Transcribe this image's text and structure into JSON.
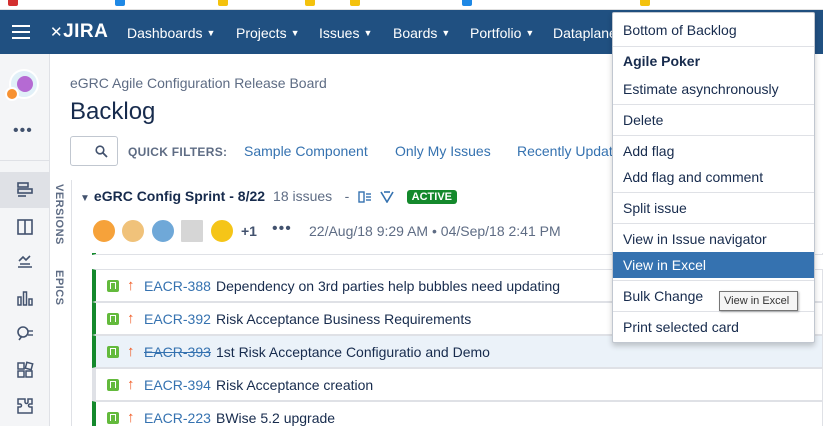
{
  "header": {
    "logo": "JIRA",
    "nav": [
      {
        "label": "Dashboards"
      },
      {
        "label": "Projects"
      },
      {
        "label": "Issues"
      },
      {
        "label": "Boards"
      },
      {
        "label": "Portfolio"
      },
      {
        "label": "Dataplane"
      }
    ]
  },
  "sidebar": {
    "more": "•••",
    "icons": [
      "backlog-icon",
      "board-icon",
      "releases-icon",
      "reports-icon",
      "issues-search-icon",
      "components-icon",
      "add-ons-icon"
    ]
  },
  "main": {
    "project_name": "eGRC Agile Configuration Release Board",
    "title": "Backlog",
    "quick_filters_label": "QUICK FILTERS:",
    "quick_filters": [
      "Sample Component",
      "Only My Issues",
      "Recently Updated"
    ],
    "side_tabs": [
      "VERSIONS",
      "EPICS"
    ]
  },
  "sprint": {
    "name": "eGRC Config Sprint - 8/22",
    "count": "18 issues",
    "status": "ACTIVE",
    "extra_assignees": "+1",
    "more": "•••",
    "start": "22/Aug/18 9:29 AM",
    "sep": "•",
    "end": "04/Sep/18 2:41 PM"
  },
  "issues": [
    {
      "key": "EACR-388",
      "summary": "Dependency on 3rd parties help bubbles need updating",
      "done": false,
      "selected": false
    },
    {
      "key": "EACR-392",
      "summary": "Risk Acceptance Business Requirements",
      "done": false,
      "selected": false
    },
    {
      "key": "EACR-393",
      "summary": "1st Risk Acceptance Configuratio and Demo",
      "done": true,
      "selected": true
    },
    {
      "key": "EACR-394",
      "summary": "Risk Acceptance creation",
      "done": false,
      "selected": false
    },
    {
      "key": "EACR-223",
      "summary": "BWise 5.2 upgrade",
      "done": false,
      "selected": false
    }
  ],
  "context_menu": {
    "items": [
      {
        "label": "Bottom of Backlog"
      },
      {
        "label": "Agile Poker",
        "bold": true
      },
      {
        "label": "Estimate asynchronously"
      },
      {
        "label": "Delete"
      },
      {
        "label": "Add flag"
      },
      {
        "label": "Add flag and comment"
      },
      {
        "label": "Split issue"
      },
      {
        "label": "View in Issue navigator"
      },
      {
        "label": "View in Excel",
        "highlighted": true
      },
      {
        "label": "Bulk Change"
      },
      {
        "label": "Print selected card"
      }
    ]
  },
  "tooltip": "View in Excel",
  "colors": {
    "nav": "#205081",
    "active": "#14892c",
    "highlight": "#3572b0"
  }
}
